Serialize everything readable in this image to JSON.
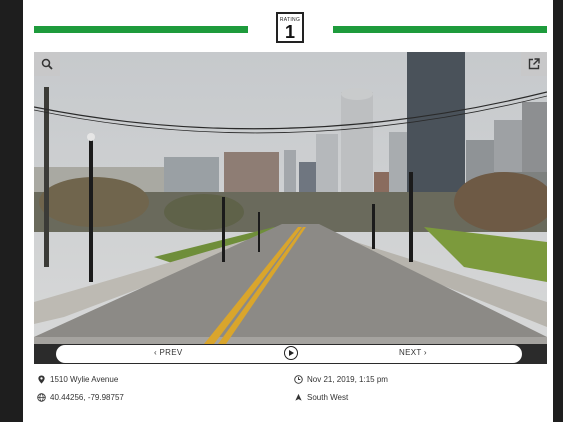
{
  "rating": {
    "caption": "RATING",
    "value": "1",
    "bar_color": "#1e9b3c"
  },
  "photo": {
    "zoom_icon": "search-icon",
    "external_icon": "external-link-icon",
    "scene": "street-view-photo"
  },
  "navigation": {
    "prev_label": "‹ PREV",
    "next_label": "NEXT ›",
    "play_icon": "play-circle-icon"
  },
  "details": {
    "address": "1510 Wylie Avenue",
    "coordinates": "40.44256, -79.98757",
    "datetime": "Nov 21, 2019, 1:15 pm",
    "direction": "South West"
  }
}
